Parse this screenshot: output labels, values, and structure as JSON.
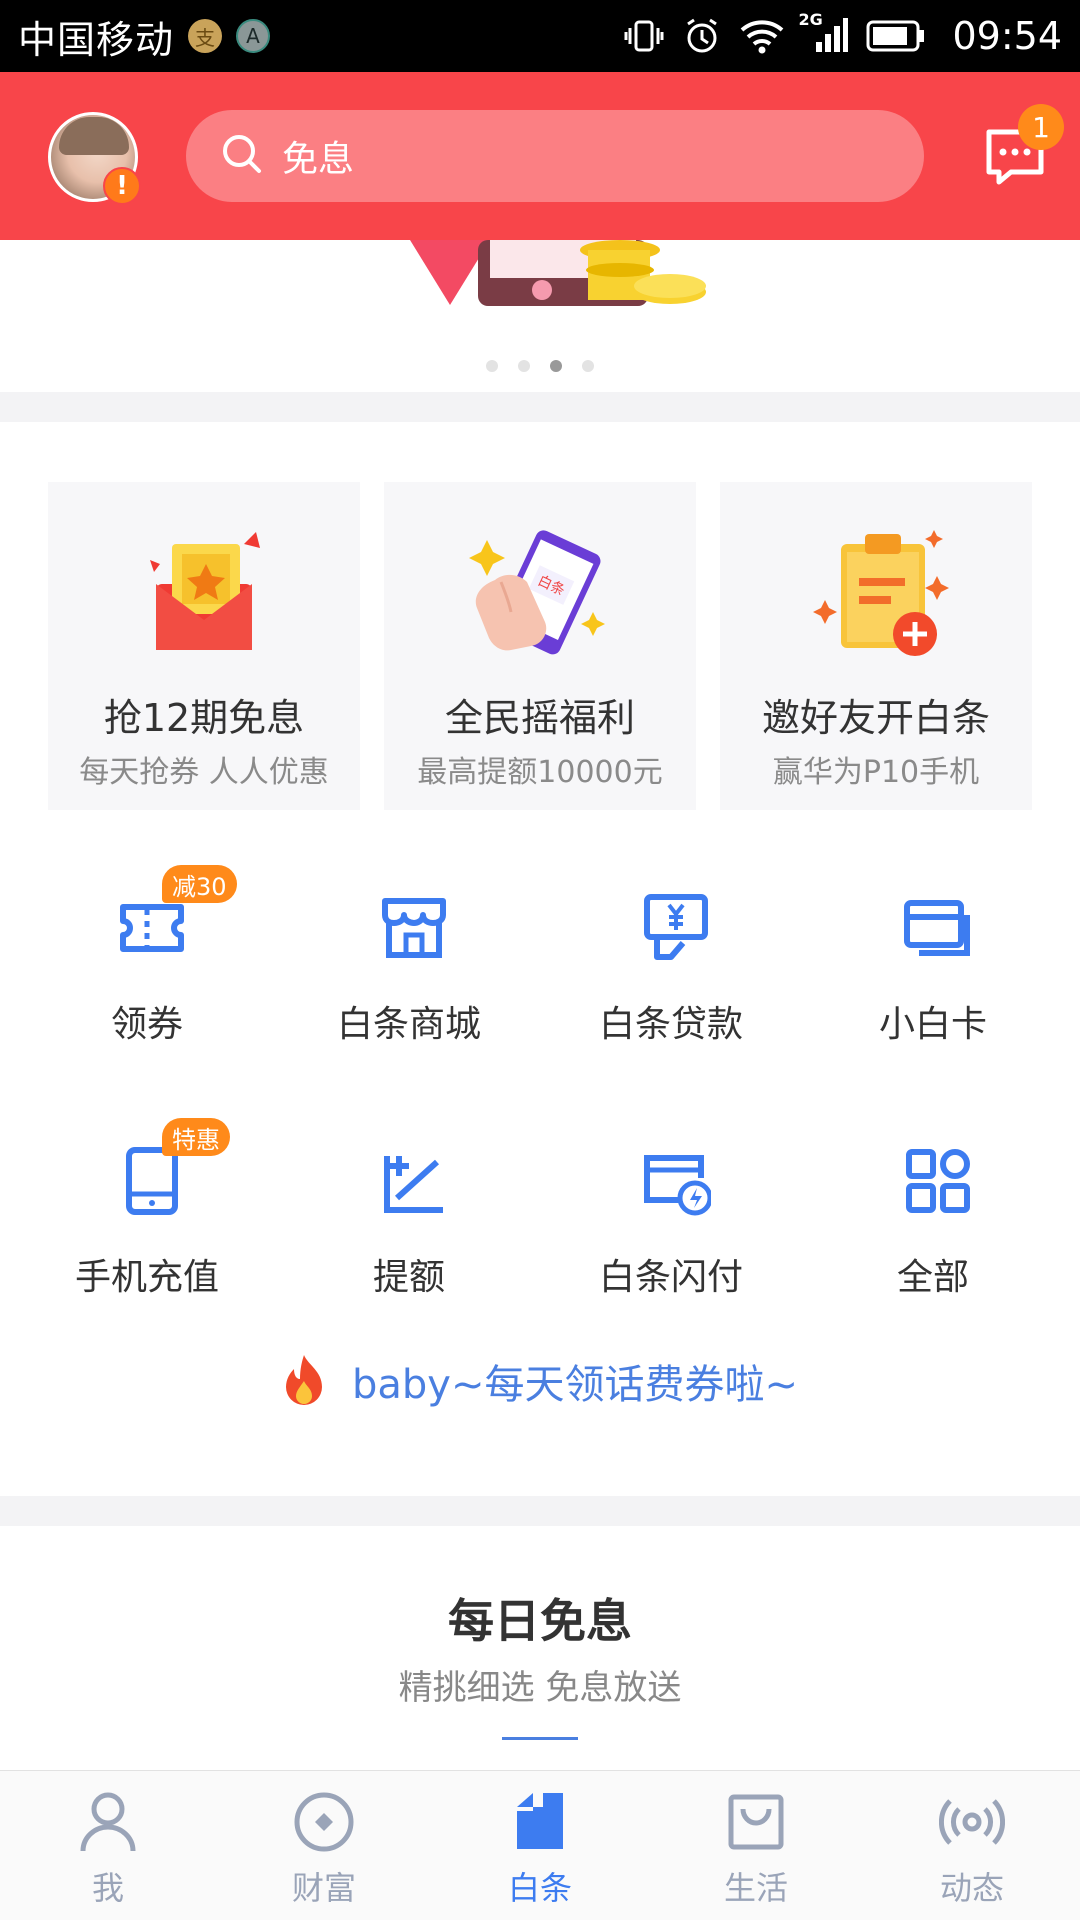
{
  "status_bar": {
    "carrier": "中国移动",
    "badge_alipay": "支",
    "badge_a": "A",
    "network": "2G",
    "time": "09:54"
  },
  "header": {
    "search_placeholder": "免息",
    "message_count": "1",
    "avatar_alert": "!"
  },
  "banner": {
    "dots": 4,
    "active_dot": 3
  },
  "promo_cards": [
    {
      "title": "抢12期免息",
      "subtitle": "每天抢券 人人优惠",
      "icon": "red-envelope-ticket-icon"
    },
    {
      "title": "全民摇福利",
      "subtitle": "最高提额10000元",
      "icon": "shake-phone-icon",
      "art_text": "白条"
    },
    {
      "title": "邀好友开白条",
      "subtitle": "赢华为P10手机",
      "icon": "invite-clipboard-icon"
    }
  ],
  "grid": [
    {
      "label": "领券",
      "icon": "coupon-icon",
      "badge": "减30"
    },
    {
      "label": "白条商城",
      "icon": "store-icon",
      "badge": ""
    },
    {
      "label": "白条贷款",
      "icon": "loan-icon",
      "badge": ""
    },
    {
      "label": "小白卡",
      "icon": "card-icon",
      "badge": ""
    },
    {
      "label": "手机充值",
      "icon": "phone-recharge-icon",
      "badge": "特惠"
    },
    {
      "label": "提额",
      "icon": "raise-limit-icon",
      "badge": ""
    },
    {
      "label": "白条闪付",
      "icon": "quickpay-icon",
      "badge": ""
    },
    {
      "label": "全部",
      "icon": "all-apps-icon",
      "badge": ""
    }
  ],
  "tip": {
    "text": "baby~每天领话费券啦~",
    "icon": "fire-icon"
  },
  "daily": {
    "title": "每日免息",
    "subtitle": "精挑细选 免息放送"
  },
  "bottom_nav": [
    {
      "label": "我",
      "icon": "person-icon",
      "active": false
    },
    {
      "label": "财富",
      "icon": "wealth-icon",
      "active": false
    },
    {
      "label": "白条",
      "icon": "baitiao-icon",
      "active": true
    },
    {
      "label": "生活",
      "icon": "bag-icon",
      "active": false
    },
    {
      "label": "动态",
      "icon": "broadcast-icon",
      "active": false
    }
  ],
  "colors": {
    "header_red": "#f8454a",
    "accent_blue": "#3d7cf0",
    "badge_orange": "#ff8a1a"
  }
}
